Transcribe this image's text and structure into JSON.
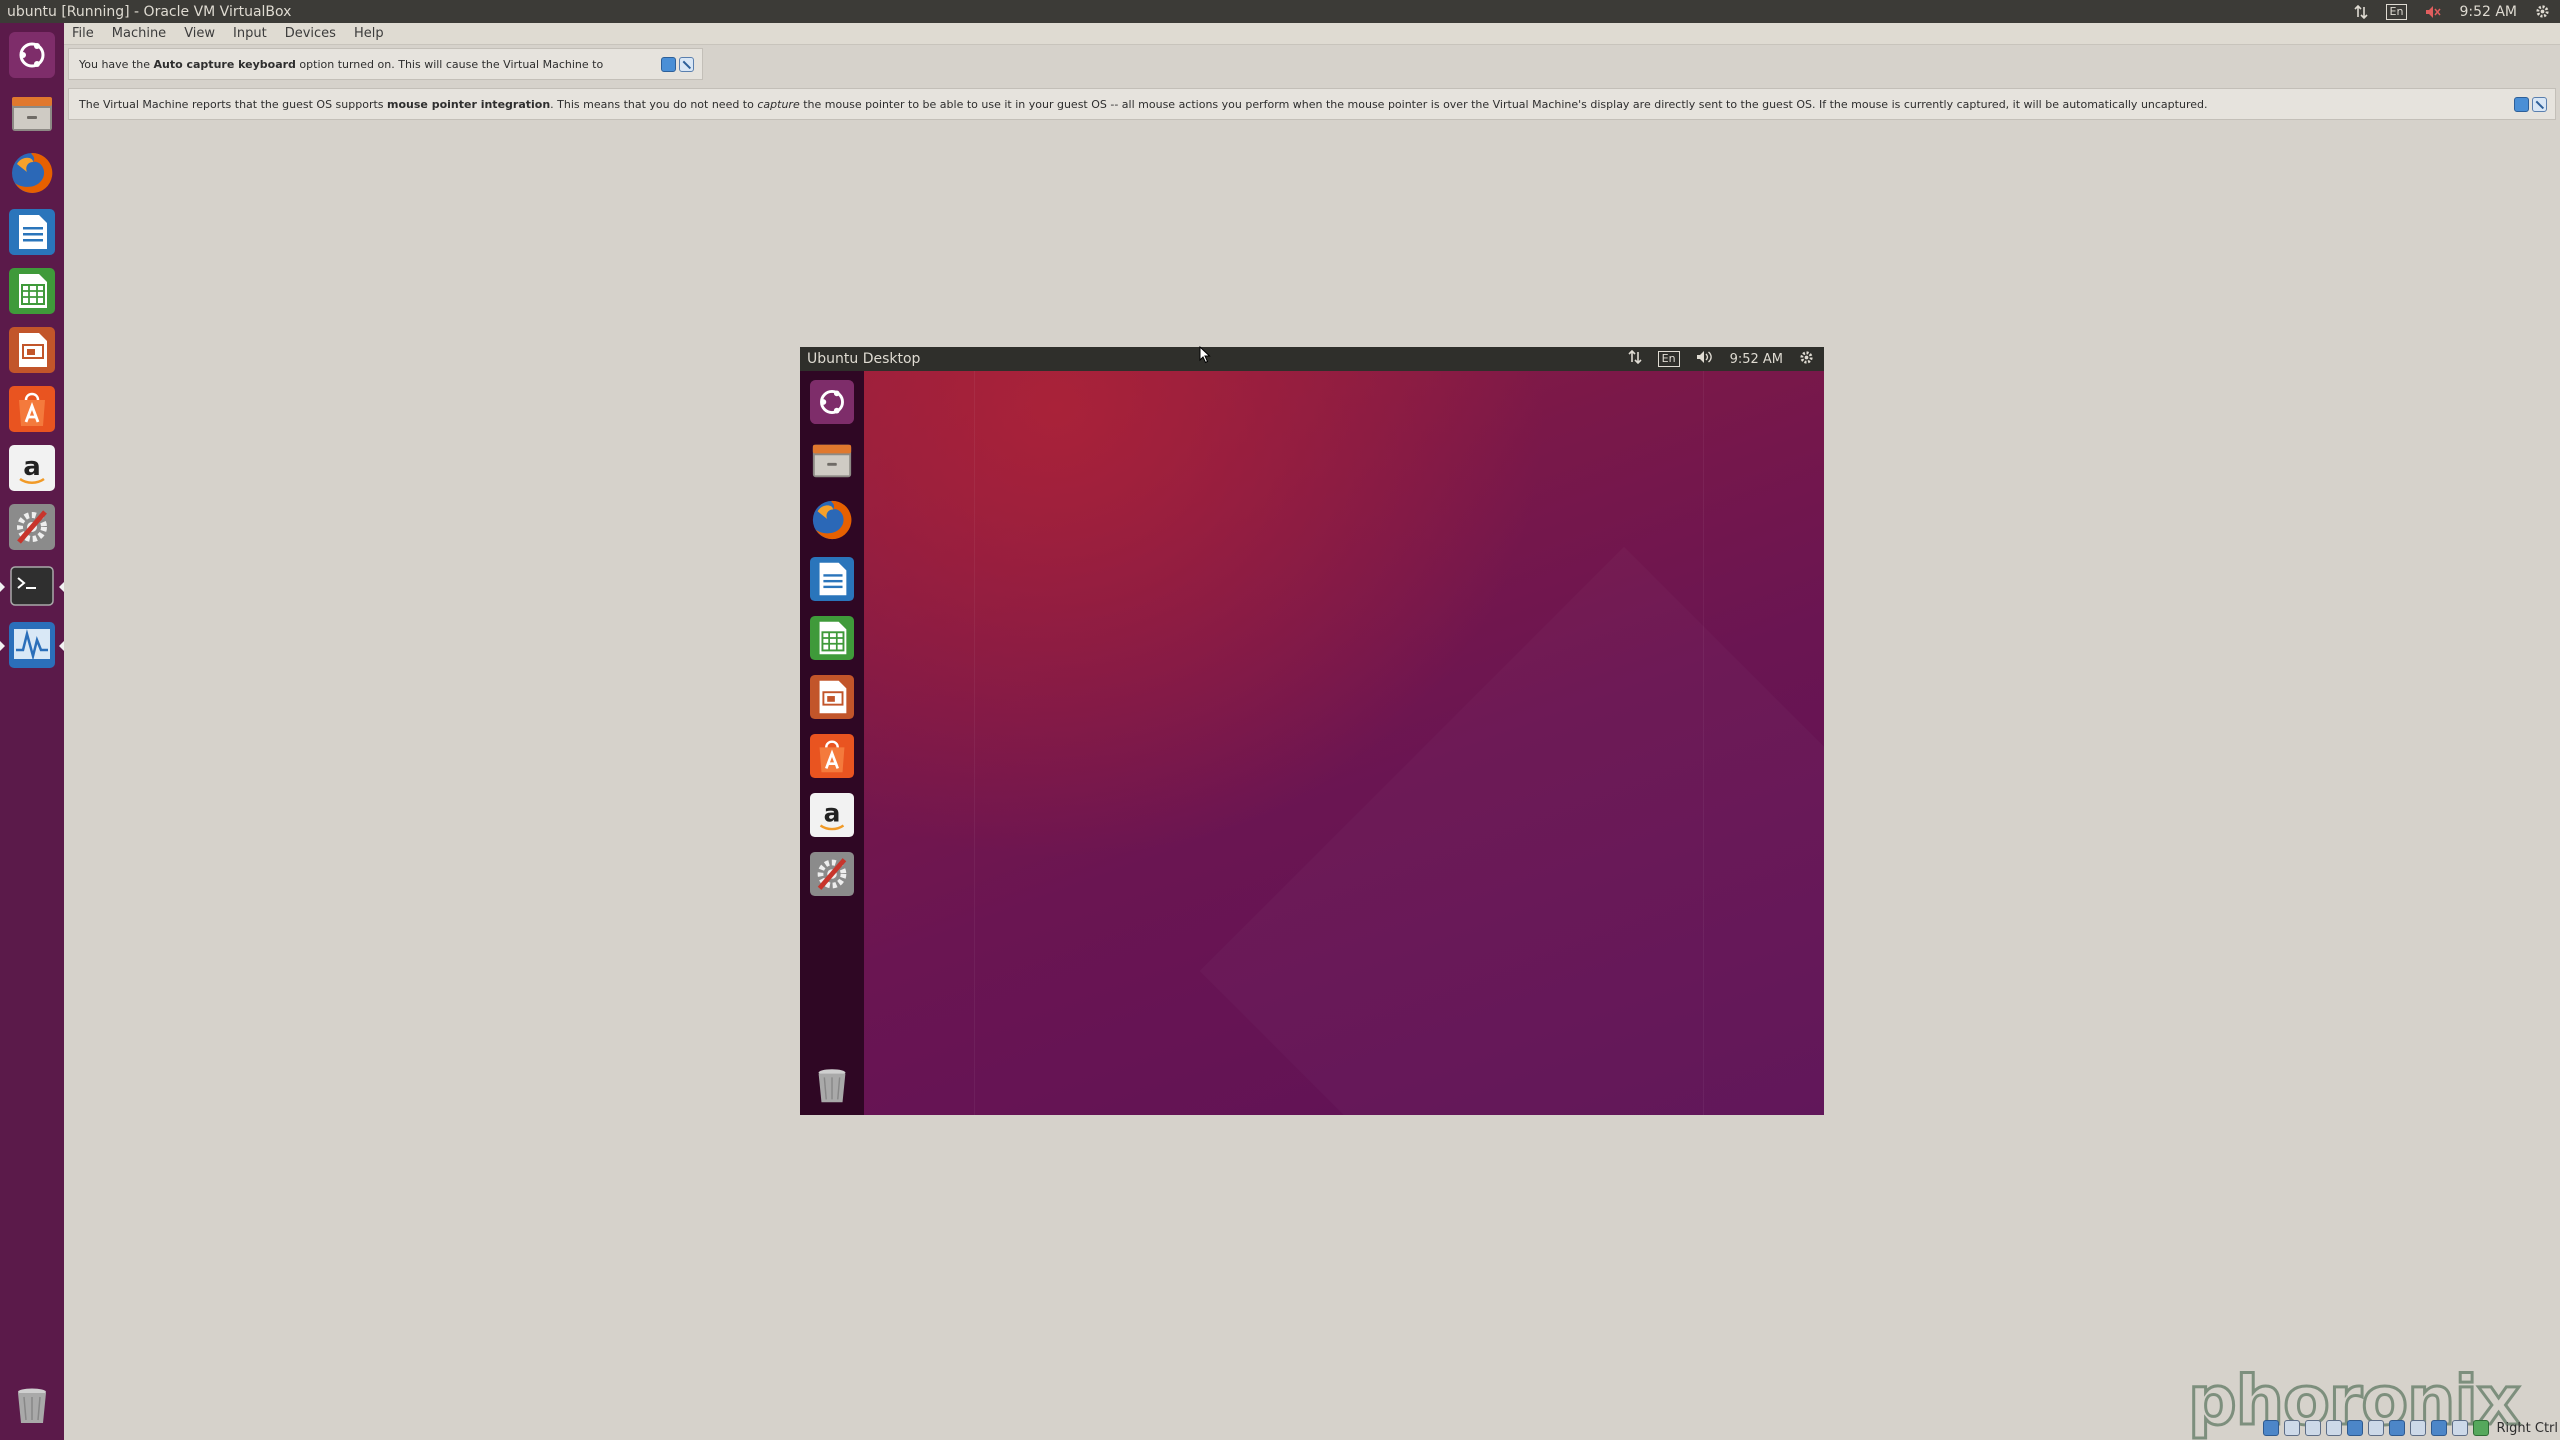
{
  "window": {
    "title": "ubuntu [Running] - Oracle VM VirtualBox"
  },
  "system_tray": {
    "keyboard_layout": "En",
    "time": "9:52 AM"
  },
  "menubar": {
    "items": [
      "File",
      "Machine",
      "View",
      "Input",
      "Devices",
      "Help"
    ]
  },
  "notices": {
    "keyboard": {
      "prefix": "You have the ",
      "bold": "Auto capture keyboard",
      "suffix": " option turned on. This will cause the Virtual Machine to"
    },
    "mouse": {
      "prefix": "The Virtual Machine reports that the guest OS supports ",
      "bold": "mouse pointer integration",
      "middle": ". This means that you do not need to ",
      "italic": "capture",
      "suffix": " the mouse pointer to be able to use it in your guest OS -- all mouse actions you perform when the mouse pointer is over the Virtual Machine's display are directly sent to the guest OS. If the mouse is currently captured, it will be automatically uncaptured."
    }
  },
  "host_launcher": {
    "items": [
      "ubuntu-dash",
      "files",
      "firefox",
      "libreoffice-writer",
      "libreoffice-calc",
      "libreoffice-impress",
      "ubuntu-software",
      "amazon",
      "system-settings",
      "terminal",
      "system-monitor",
      "trash"
    ]
  },
  "guest": {
    "title": "Ubuntu Desktop",
    "keyboard_layout": "En",
    "time": "9:52 AM",
    "launcher_items": [
      "ubuntu-dash",
      "files",
      "firefox",
      "libreoffice-writer",
      "libreoffice-calc",
      "libreoffice-impress",
      "ubuntu-software",
      "amazon",
      "system-settings",
      "trash"
    ]
  },
  "statusbar": {
    "host_key": "Right Ctrl"
  },
  "watermark": {
    "text": "phoronix"
  },
  "colors": {
    "host_panel": "#3c3b37",
    "host_launcher": "#5b1a4a",
    "guest_desktop": "#7a1849",
    "accent_orange": "#e95420"
  }
}
